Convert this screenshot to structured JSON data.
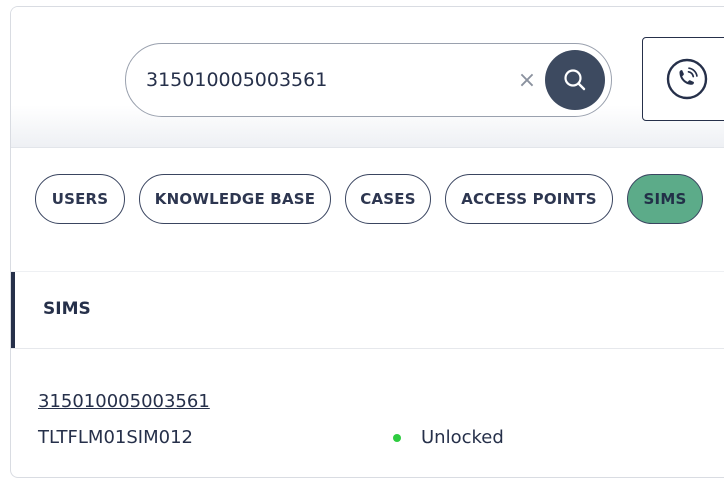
{
  "search": {
    "value": "315010005003561",
    "clear_symbol": "×"
  },
  "filters": [
    {
      "label": "USERS",
      "active": false
    },
    {
      "label": "KNOWLEDGE BASE",
      "active": false
    },
    {
      "label": "CASES",
      "active": false
    },
    {
      "label": "ACCESS POINTS",
      "active": false
    },
    {
      "label": "SIMS",
      "active": true
    }
  ],
  "section": {
    "title": "SIMS"
  },
  "results": [
    {
      "id": "315010005003561",
      "name": "TLTFLM01SIM012",
      "status": "Unlocked",
      "status_color": "#2ecc40"
    }
  ],
  "colors": {
    "primary": "#26304a",
    "active_chip": "#5cab89",
    "search_button": "#3d4a60"
  },
  "icons": {
    "search": "search-icon",
    "clear": "close-icon",
    "phone": "phone-icon"
  }
}
